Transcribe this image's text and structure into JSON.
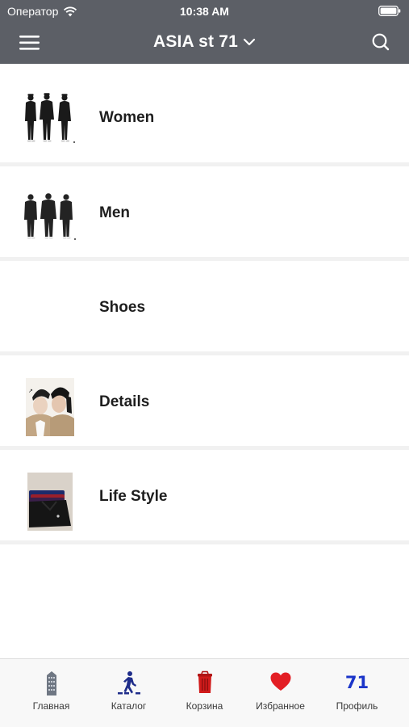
{
  "status_bar": {
    "carrier": "Оператор",
    "time": "10:38 AM"
  },
  "header": {
    "title": "ASIA st 71"
  },
  "categories": [
    {
      "label": "Women",
      "thumb": "women-group-photo"
    },
    {
      "label": "Men",
      "thumb": "men-group-photo"
    },
    {
      "label": "Shoes",
      "thumb": ""
    },
    {
      "label": "Details",
      "thumb": "details-portrait-photo"
    },
    {
      "label": "Life Style",
      "thumb": "lifestyle-folded-clothes-photo"
    }
  ],
  "tab_bar": {
    "tabs": [
      {
        "label": "Главная",
        "icon": "building-icon"
      },
      {
        "label": "Каталог",
        "icon": "crosswalk-icon"
      },
      {
        "label": "Корзина",
        "icon": "trash-bin-icon"
      },
      {
        "label": "Избранное",
        "icon": "heart-icon"
      },
      {
        "label": "Профиль",
        "icon": "71",
        "icon_color": "#1b35c9"
      }
    ]
  },
  "colors": {
    "header_bg": "#5c5f66",
    "favorite": "#e31e24",
    "cart": "#d11b1b"
  }
}
